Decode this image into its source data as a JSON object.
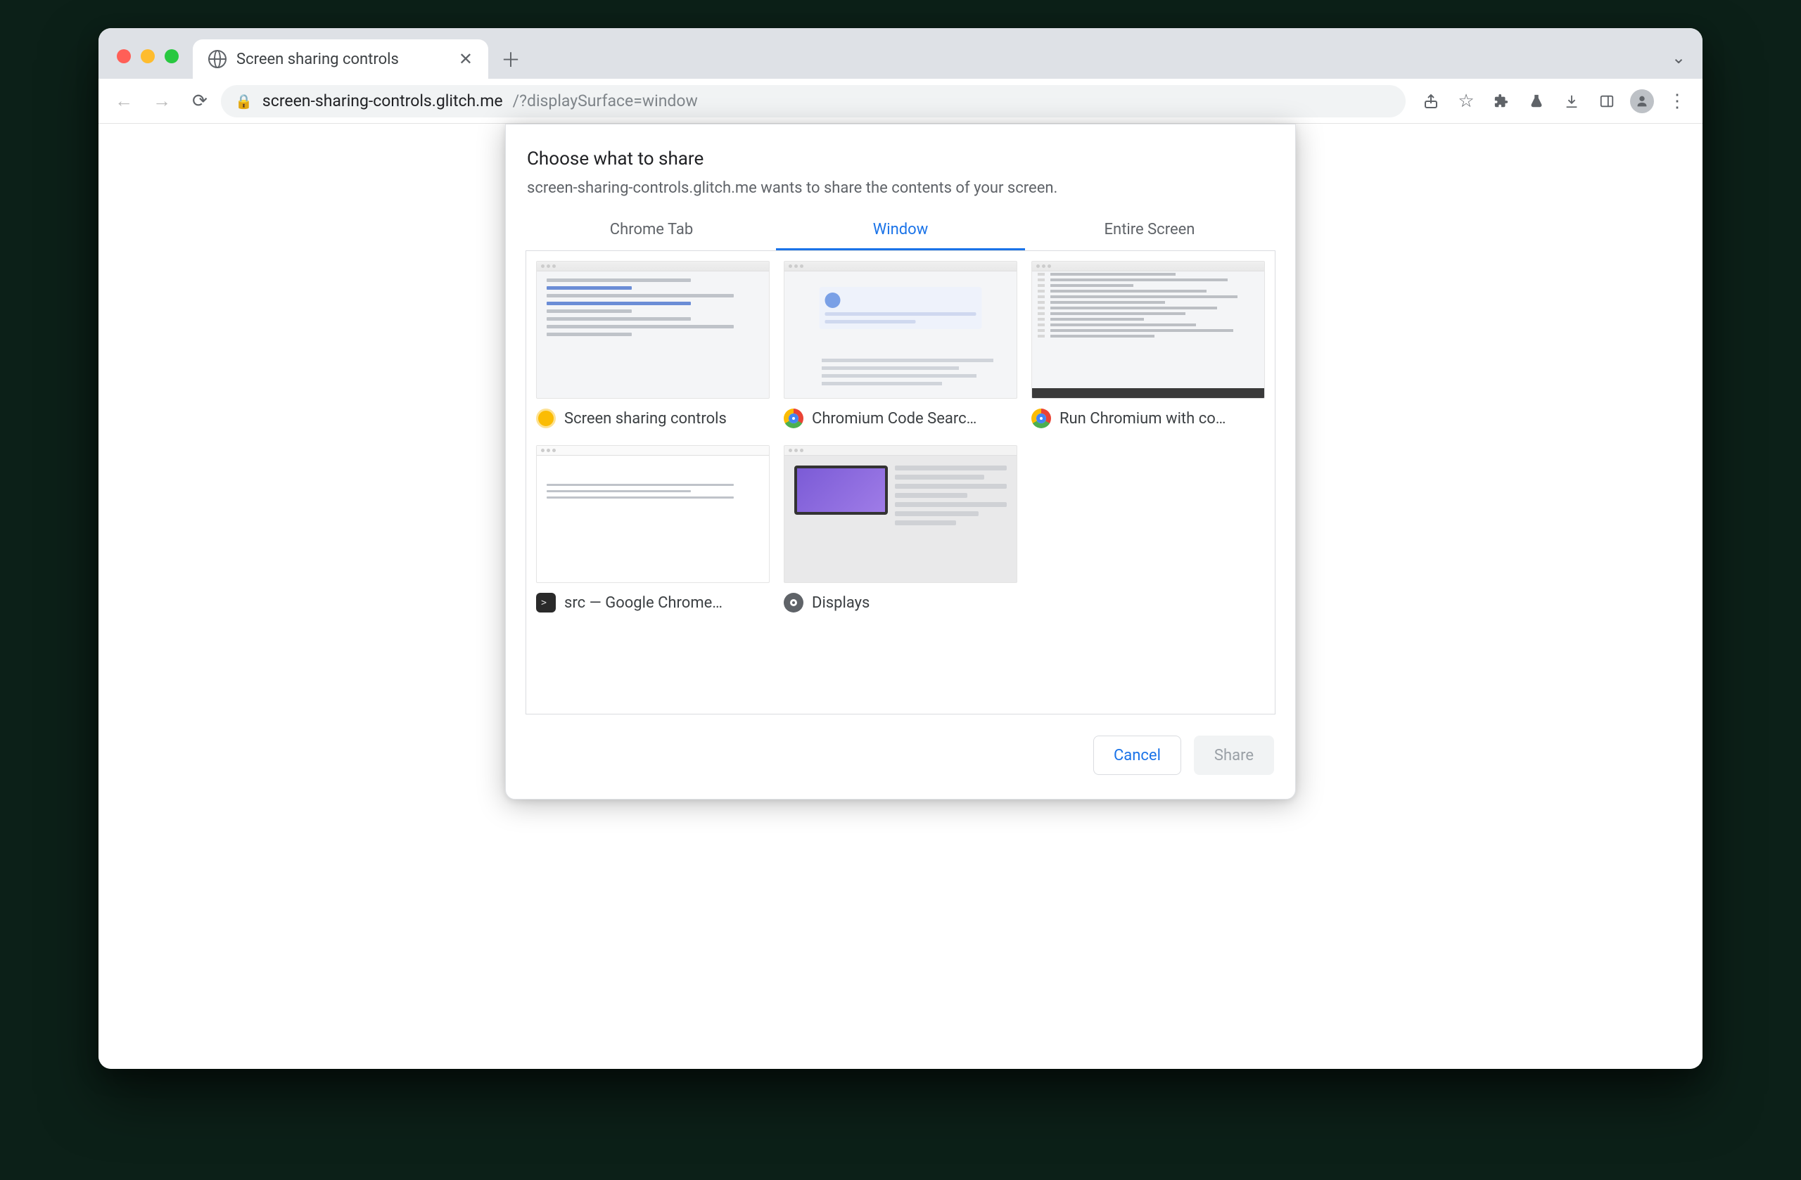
{
  "tab": {
    "title": "Screen sharing controls"
  },
  "url": {
    "host": "screen-sharing-controls.glitch.me",
    "path": "/?displaySurface=window"
  },
  "modal": {
    "title": "Choose what to share",
    "subtitle": "screen-sharing-controls.glitch.me wants to share the contents of your screen.",
    "tabs": {
      "chrome_tab": "Chrome Tab",
      "window": "Window",
      "entire_screen": "Entire Screen"
    },
    "active_tab": "window",
    "items": [
      {
        "label": "Screen sharing controls",
        "icon": "canary"
      },
      {
        "label": "Chromium Code Searc…",
        "icon": "chrome"
      },
      {
        "label": "Run Chromium with co…",
        "icon": "chrome"
      },
      {
        "label": "src — Google Chrome…",
        "icon": "term"
      },
      {
        "label": "Displays",
        "icon": "gear"
      }
    ],
    "buttons": {
      "cancel": "Cancel",
      "share": "Share"
    }
  }
}
